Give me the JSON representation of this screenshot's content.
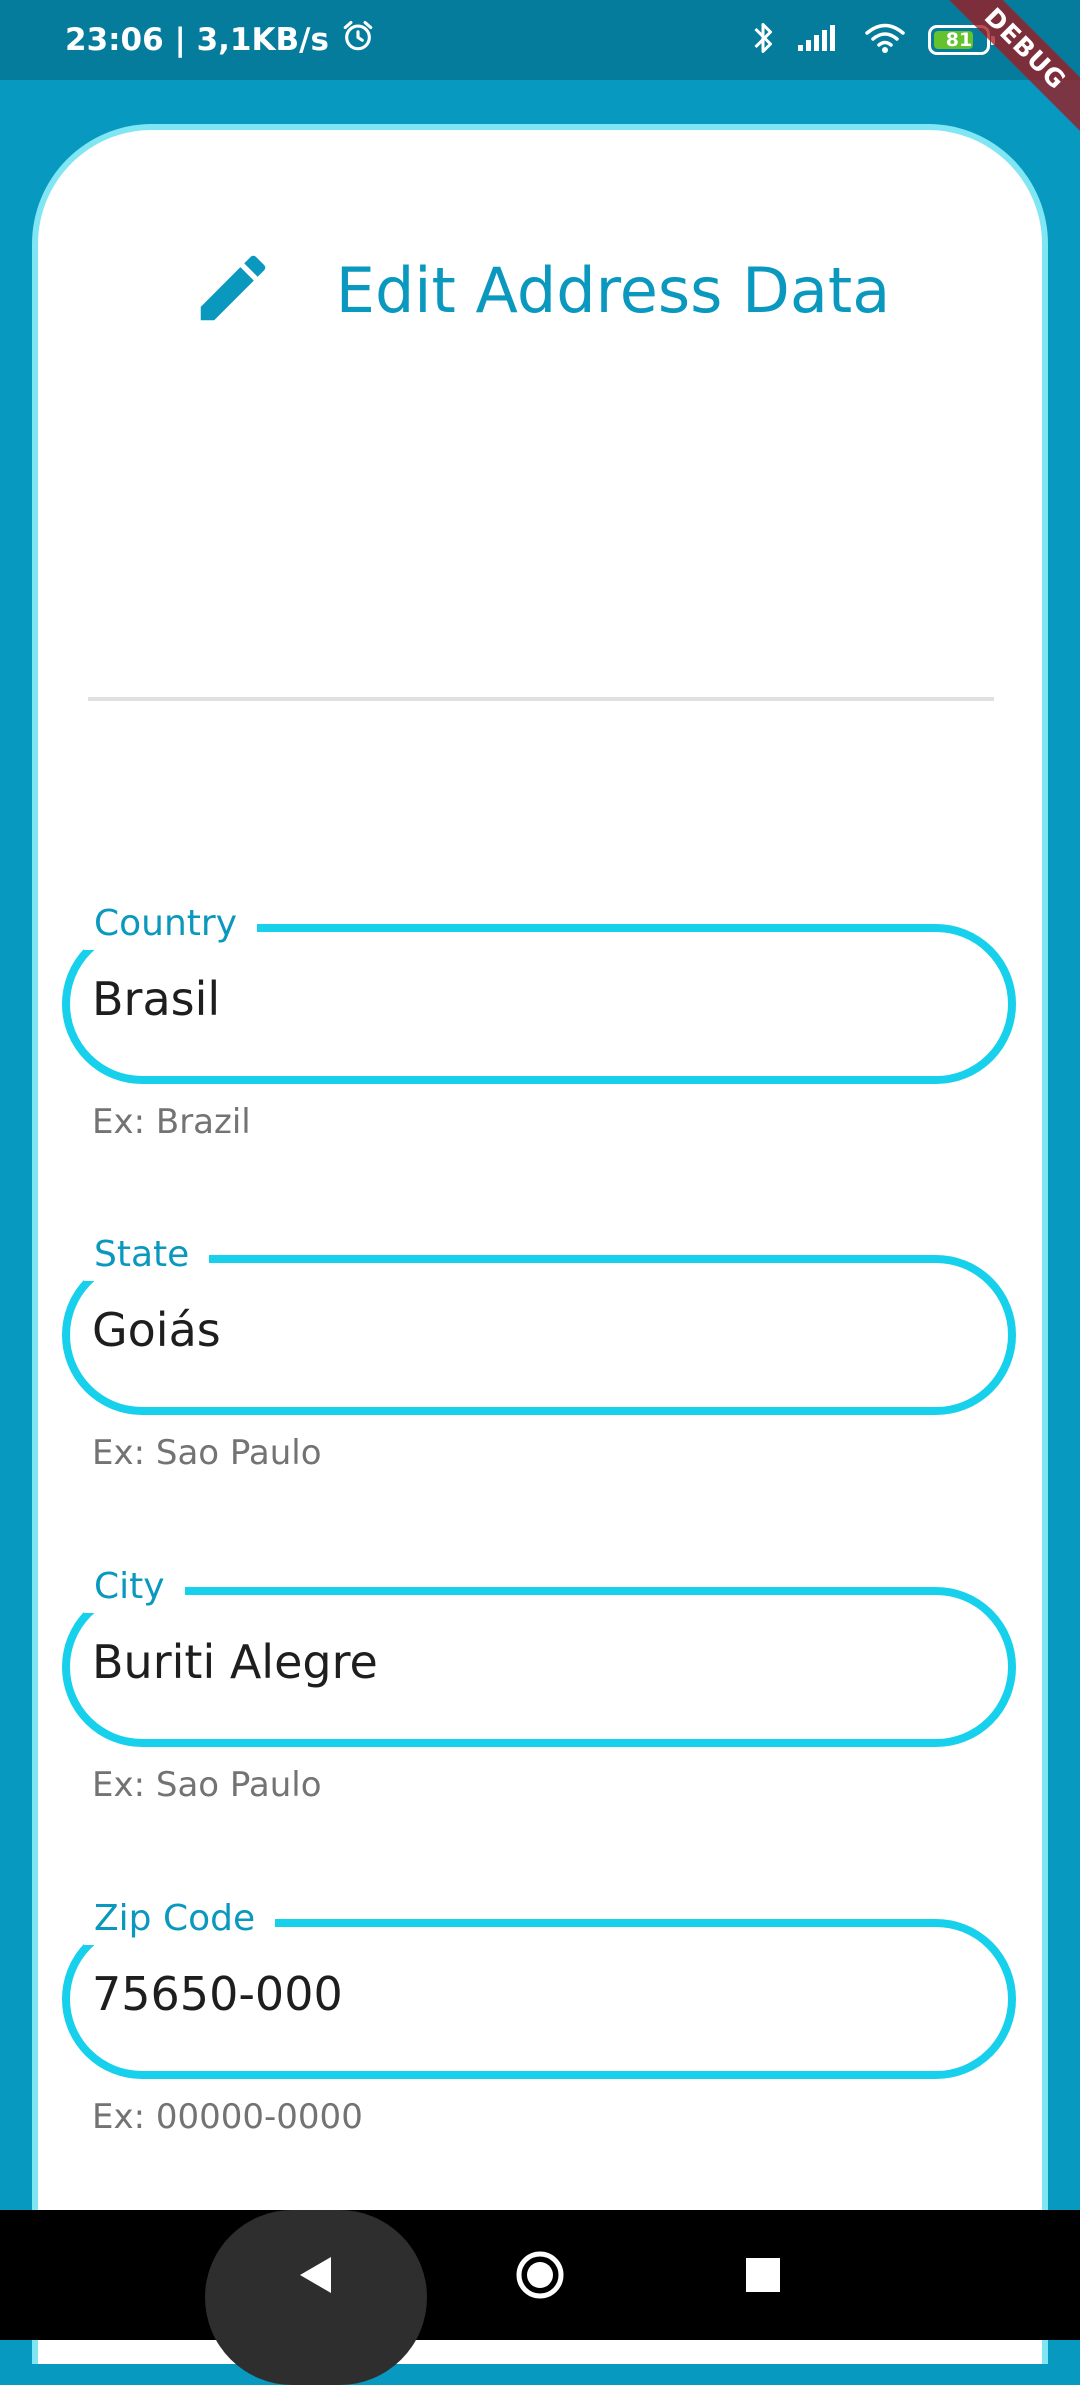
{
  "status_bar": {
    "time_speed": "23:06 | 3,1KB/s",
    "battery_level": "81",
    "icons": [
      "alarm-icon",
      "bluetooth-icon",
      "signal-icon",
      "wifi-icon",
      "battery-icon"
    ]
  },
  "debug_banner": "DEBUG",
  "header": {
    "icon": "pencil-icon",
    "title": "Edit Address Data"
  },
  "fields": [
    {
      "label": "Country",
      "value": "Brasil",
      "helper": "Ex: Brazil"
    },
    {
      "label": "State",
      "value": "Goiás",
      "helper": "Ex: Sao Paulo"
    },
    {
      "label": "City",
      "value": "Buriti Alegre",
      "helper": "Ex: Sao Paulo"
    },
    {
      "label": "Zip Code",
      "value": "75650-000",
      "helper": "Ex: 00000-0000"
    }
  ],
  "nav": {
    "icons": [
      "back-icon",
      "home-icon",
      "recents-icon"
    ]
  },
  "colors": {
    "primary": "#0a98be",
    "accent_border": "#16d0ec",
    "background": "#0799c0",
    "status_bar": "#067c9c"
  }
}
